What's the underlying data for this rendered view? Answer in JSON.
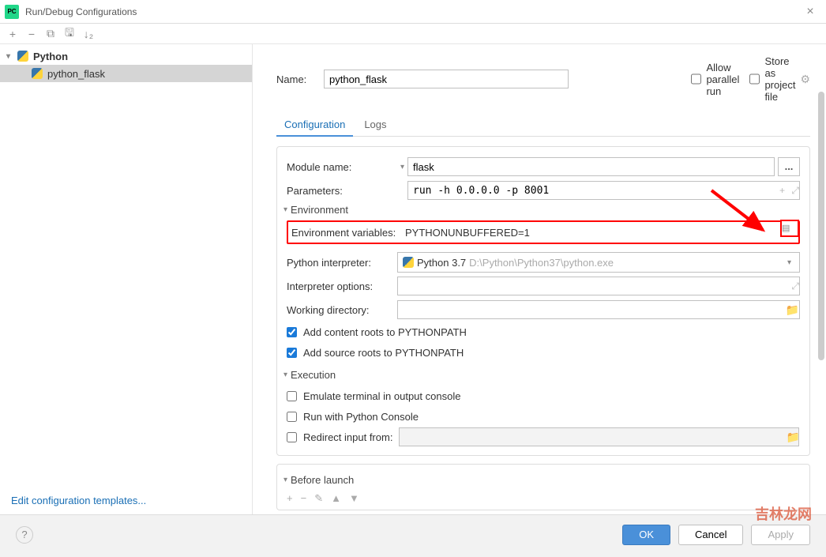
{
  "window": {
    "title": "Run/Debug Configurations"
  },
  "tree": {
    "group": "Python",
    "item": "python_flask"
  },
  "edit_templates": "Edit configuration templates...",
  "form": {
    "name_label": "Name:",
    "name_value": "python_flask",
    "allow_parallel": "Allow parallel run",
    "store_project": "Store as project file",
    "tabs": {
      "configuration": "Configuration",
      "logs": "Logs"
    },
    "module_name_label": "Module name:",
    "module_name_value": "flask",
    "parameters_label": "Parameters:",
    "parameters_value": "run -h 0.0.0.0 -p 8001",
    "env_header": "Environment",
    "env_vars_label": "Environment variables:",
    "env_vars_value": "PYTHONUNBUFFERED=1",
    "interpreter_label": "Python interpreter:",
    "interpreter_name": "Python 3.7",
    "interpreter_path": "D:\\Python\\Python37\\python.exe",
    "interp_options_label": "Interpreter options:",
    "workdir_label": "Working directory:",
    "add_content_roots": "Add content roots to PYTHONPATH",
    "add_source_roots": "Add source roots to PYTHONPATH",
    "execution_header": "Execution",
    "emulate_terminal": "Emulate terminal in output console",
    "run_python_console": "Run with Python Console",
    "redirect_input": "Redirect input from:",
    "before_launch": "Before launch"
  },
  "footer": {
    "ok": "OK",
    "cancel": "Cancel",
    "apply": "Apply"
  },
  "watermark": "吉林龙网"
}
